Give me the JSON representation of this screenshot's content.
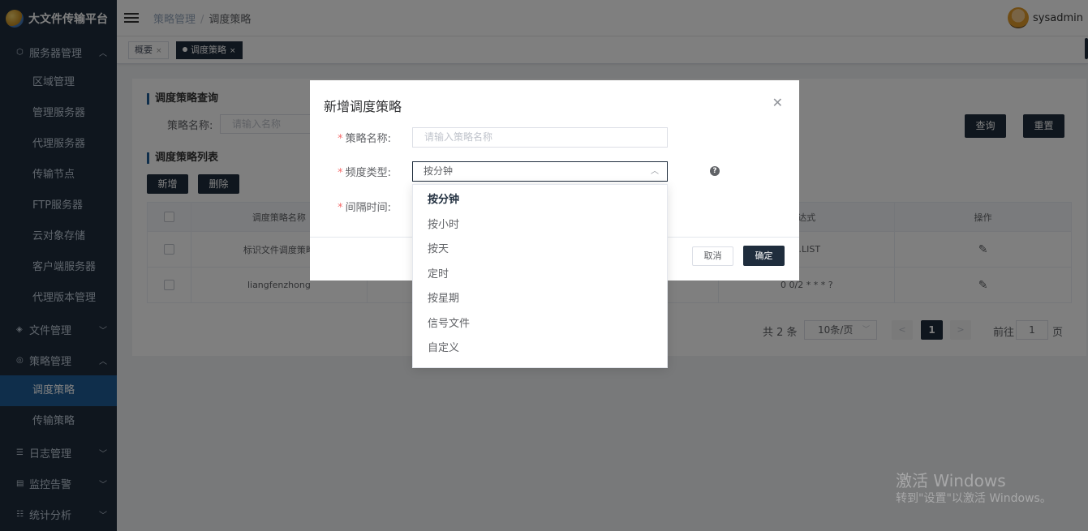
{
  "app": {
    "title": "大文件传输平台"
  },
  "sidebar": {
    "groups": [
      {
        "label": "服务器管理",
        "icon": "cube-icon",
        "expanded": true,
        "items": [
          "区域管理",
          "管理服务器",
          "代理服务器",
          "传输节点",
          "FTP服务器",
          "云对象存储",
          "客户端服务器",
          "代理版本管理"
        ]
      },
      {
        "label": "文件管理",
        "icon": "layers-icon",
        "expanded": false,
        "items": []
      },
      {
        "label": "策略管理",
        "icon": "policy-icon",
        "expanded": true,
        "items": [
          "调度策略",
          "传输策略"
        ],
        "active": "调度策略"
      },
      {
        "label": "日志管理",
        "icon": "list-icon",
        "expanded": false,
        "items": []
      },
      {
        "label": "监控告警",
        "icon": "monitor-icon",
        "expanded": false,
        "items": []
      },
      {
        "label": "统计分析",
        "icon": "chart-icon",
        "expanded": false,
        "items": []
      }
    ]
  },
  "header": {
    "breadcrumb": [
      "策略管理",
      "调度策略"
    ],
    "user": "sysadmin"
  },
  "tags": [
    {
      "label": "概要",
      "active": false
    },
    {
      "label": "调度策略",
      "active": true
    }
  ],
  "query": {
    "title": "调度策略查询",
    "name_label": "策略名称:",
    "name_placeholder": "请输入名称",
    "search_button": "查询",
    "reset_button": "重置"
  },
  "list": {
    "title": "调度策略列表",
    "add_button": "新增",
    "delete_button": "删除",
    "columns": [
      "调度策略名称",
      "达式",
      "操作"
    ],
    "rows": [
      {
        "name": "标识文件调度策略",
        "expr": "E.LIST"
      },
      {
        "name": "liangfenzhong",
        "expr": "0 0/2 * * * ?"
      }
    ]
  },
  "pagination": {
    "total": "共 2 条",
    "page_size": "10条/页",
    "current": "1",
    "goto_label": "前往",
    "goto_value": "1",
    "page_suffix": "页"
  },
  "dialog": {
    "title": "新增调度策略",
    "fields": {
      "name_label": "策略名称:",
      "name_placeholder": "请输入策略名称",
      "freq_label": "频度类型:",
      "freq_value": "按分钟",
      "interval_label": "间隔时间:"
    },
    "cancel": "取消",
    "ok": "确定"
  },
  "dropdown": {
    "options": [
      "按分钟",
      "按小时",
      "按天",
      "定时",
      "按星期",
      "信号文件",
      "自定义"
    ],
    "selected": "按分钟"
  },
  "watermark": {
    "line1": "激活 Windows",
    "line2": "转到\"设置\"以激活 Windows。"
  }
}
